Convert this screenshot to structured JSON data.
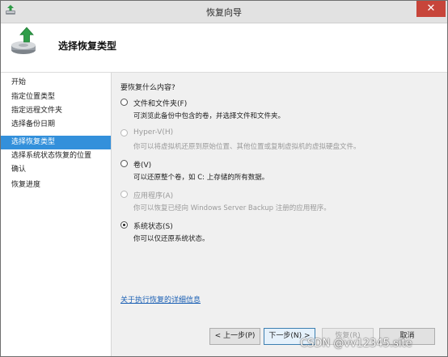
{
  "window": {
    "title": "恢复向导",
    "close_symbol": "✕"
  },
  "header": {
    "title": "选择恢复类型"
  },
  "sidebar": {
    "steps": [
      {
        "label": "开始"
      },
      {
        "label": "指定位置类型"
      },
      {
        "label": "指定远程文件夹"
      },
      {
        "label": "选择备份日期"
      },
      {
        "label": "选择恢复类型",
        "active": true
      },
      {
        "label": "选择系统状态恢复的位置"
      },
      {
        "label": "确认"
      },
      {
        "label": "恢复进度"
      }
    ]
  },
  "main": {
    "question": "要恢复什么内容?",
    "options": [
      {
        "label": "文件和文件夹(F)",
        "desc": "可浏览此备份中包含的卷，并选择文件和文件夹。",
        "checked": false,
        "enabled": true
      },
      {
        "label": "Hyper-V(H)",
        "desc": "你可以将虚拟机还原到原始位置、其他位置或复制虚拟机的虚拟硬盘文件。",
        "checked": false,
        "enabled": false
      },
      {
        "label": "卷(V)",
        "desc": "可以还原整个卷，如 C: 上存储的所有数据。",
        "checked": false,
        "enabled": true
      },
      {
        "label": "应用程序(A)",
        "desc": "你可以恢复已经向 Windows Server Backup 注册的应用程序。",
        "checked": false,
        "enabled": false
      },
      {
        "label": "系统状态(S)",
        "desc": "你可以仅还原系统状态。",
        "checked": true,
        "enabled": true
      }
    ],
    "more_info_link": "关于执行恢复的详细信息"
  },
  "buttons": {
    "back": "< 上一步(P)",
    "next": "下一步(N) >",
    "recover": "恢复(R)",
    "cancel": "取消"
  },
  "watermark": "CSDN @vv12345.site"
}
